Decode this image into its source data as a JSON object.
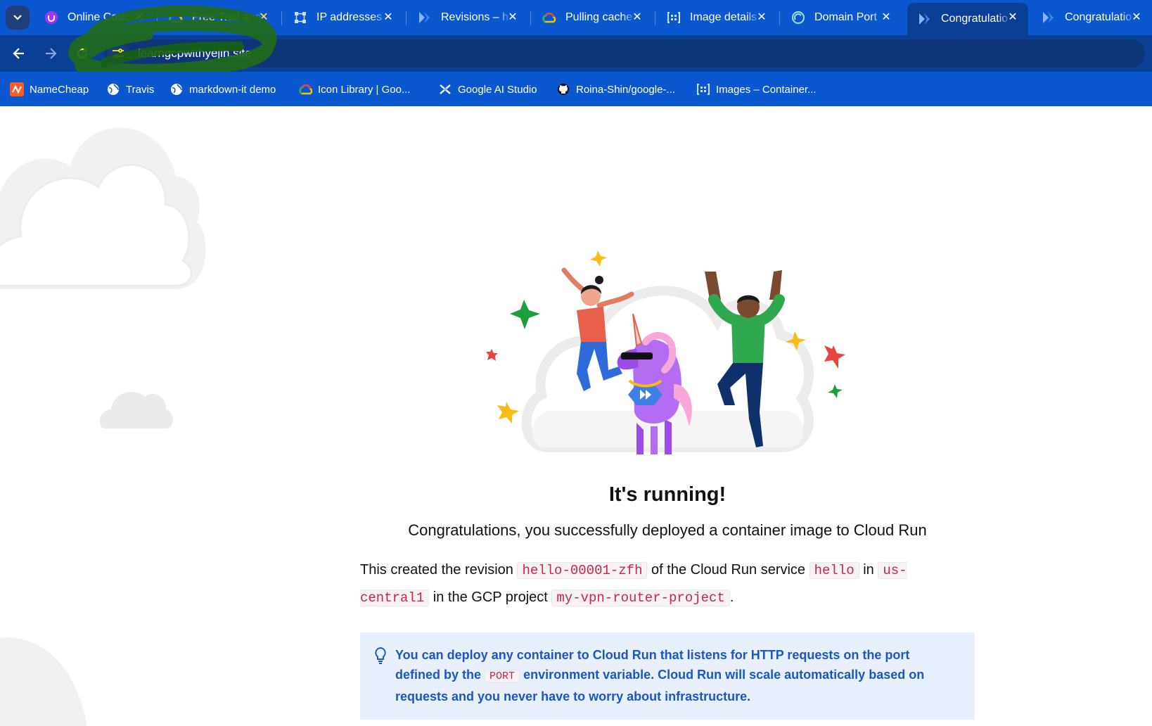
{
  "tabs": [
    {
      "title": "Online Cours",
      "icon": "udemy-icon",
      "active": false
    },
    {
      "title": "Free Trial and",
      "icon": "google-cloud-icon",
      "active": false
    },
    {
      "title": "IP addresses",
      "icon": "network-icon",
      "active": false
    },
    {
      "title": "Revisions – h",
      "icon": "cloud-run-icon",
      "active": false
    },
    {
      "title": "Pulling cache",
      "icon": "google-cloud-icon",
      "active": false
    },
    {
      "title": "Image details",
      "icon": "artifact-registry-icon",
      "active": false
    },
    {
      "title": "Domain Port",
      "icon": "domain-icon",
      "active": false
    },
    {
      "title": "Congratulatio",
      "icon": "cloud-run-icon",
      "active": true
    },
    {
      "title": "Congratulatio",
      "icon": "cloud-run-icon",
      "active": false
    }
  ],
  "toolbar": {
    "url": "learngcpwithyejin.site"
  },
  "bookmarks": [
    {
      "label": "NameCheap",
      "icon": "namecheap-icon"
    },
    {
      "label": "Travis",
      "icon": "globe-icon"
    },
    {
      "label": "markdown-it demo",
      "icon": "globe-icon"
    },
    {
      "label": "Icon Library | Goo...",
      "icon": "google-cloud-icon"
    },
    {
      "label": "Google AI Studio",
      "icon": "ai-studio-icon"
    },
    {
      "label": "Roina-Shin/google-...",
      "icon": "github-icon"
    },
    {
      "label": "Images – Container...",
      "icon": "artifact-registry-icon"
    }
  ],
  "page": {
    "headline": "It's running!",
    "subline": "Congratulations, you successfully deployed a container image to Cloud Run",
    "rev_prefix": "This created the revision",
    "revision": "hello-00001-zfh",
    "rev_mid1": "of the Cloud Run service",
    "service": "hello",
    "rev_mid2": "in",
    "region": "us-central1",
    "rev_mid3": "in the GCP project",
    "project": "my-vpn-router-project",
    "rev_end": ".",
    "tip_part1": "You can deploy any container to Cloud Run that listens for HTTP requests on the port defined by the",
    "tip_code": "PORT",
    "tip_part2": "environment variable. Cloud Run will scale automatically based on requests and you never have to worry about infrastructure."
  }
}
